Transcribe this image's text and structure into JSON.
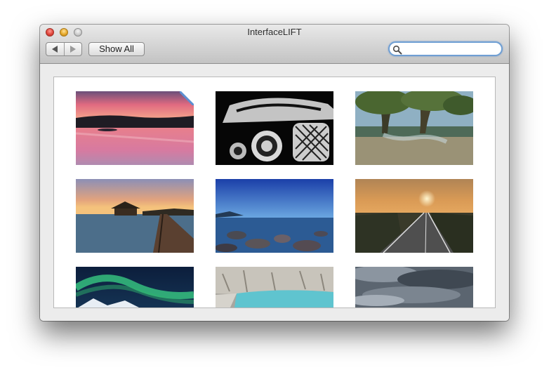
{
  "window": {
    "title": "InterfaceLIFT"
  },
  "toolbar": {
    "show_all_label": "Show All"
  },
  "search": {
    "value": "",
    "placeholder": ""
  },
  "grid": {
    "items": [
      {
        "name": "wallpaper-pink-sunset-lake"
      },
      {
        "name": "wallpaper-car-grille-bw"
      },
      {
        "name": "wallpaper-swamp-trees"
      },
      {
        "name": "wallpaper-overwater-bungalow-dock"
      },
      {
        "name": "wallpaper-blue-rocky-shore"
      },
      {
        "name": "wallpaper-desert-road-sunset"
      },
      {
        "name": "wallpaper-aurora-mountains"
      },
      {
        "name": "wallpaper-glacier-lake"
      },
      {
        "name": "wallpaper-stormy-clouds"
      }
    ]
  },
  "colors": {
    "accent": "#6f9fd3",
    "selection": "#5c8fd1"
  }
}
